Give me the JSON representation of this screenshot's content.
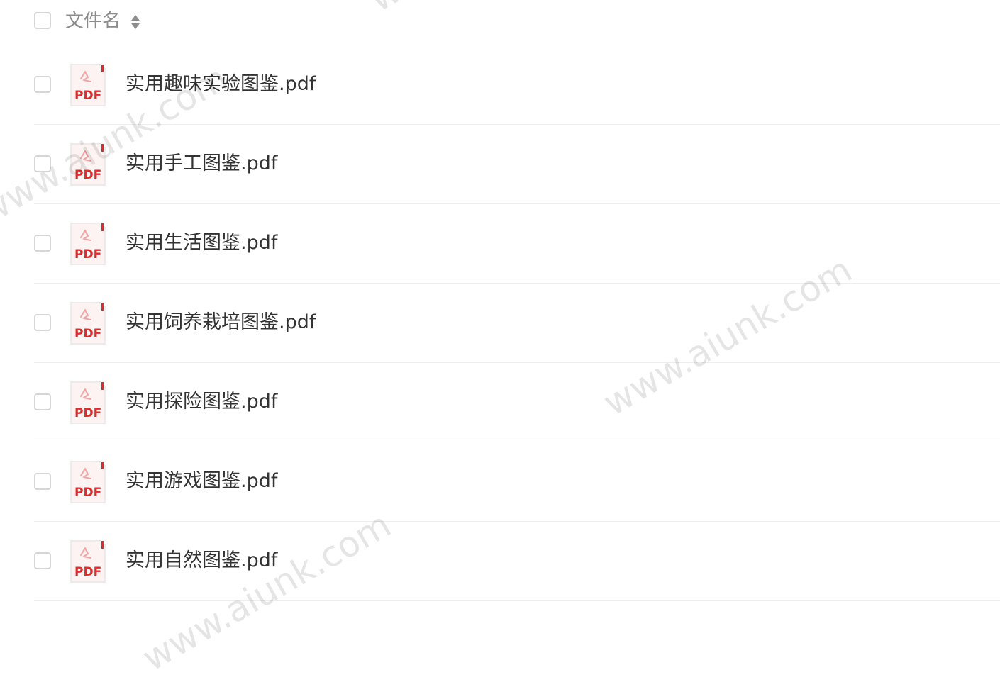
{
  "header": {
    "column_label": "文件名",
    "sort_icon": "sort-icon"
  },
  "files": [
    {
      "name": "实用趣味实验图鉴.pdf",
      "icon": "pdf-icon",
      "icon_label": "PDF"
    },
    {
      "name": "实用手工图鉴.pdf",
      "icon": "pdf-icon",
      "icon_label": "PDF"
    },
    {
      "name": "实用生活图鉴.pdf",
      "icon": "pdf-icon",
      "icon_label": "PDF"
    },
    {
      "name": "实用饲养栽培图鉴.pdf",
      "icon": "pdf-icon",
      "icon_label": "PDF"
    },
    {
      "name": "实用探险图鉴.pdf",
      "icon": "pdf-icon",
      "icon_label": "PDF"
    },
    {
      "name": "实用游戏图鉴.pdf",
      "icon": "pdf-icon",
      "icon_label": "PDF"
    },
    {
      "name": "实用自然图鉴.pdf",
      "icon": "pdf-icon",
      "icon_label": "PDF"
    }
  ],
  "watermark": {
    "text": "www.aiunk.com"
  },
  "colors": {
    "pdf_red": "#e02b2b",
    "text": "#333333",
    "muted": "#8c8c8c"
  }
}
